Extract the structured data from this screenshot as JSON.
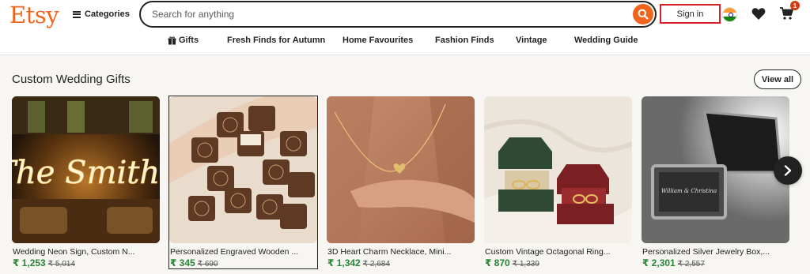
{
  "header": {
    "logo": "Etsy",
    "categories_label": "Categories",
    "search_placeholder": "Search for anything",
    "signin_label": "Sign in",
    "cart_count": "1"
  },
  "nav": {
    "items": [
      "Gifts",
      "Fresh Finds for Autumn",
      "Home Favourites",
      "Fashion Finds",
      "Vintage",
      "Wedding Guide"
    ]
  },
  "section": {
    "title": "Custom Wedding Gifts",
    "view_all_label": "View all"
  },
  "products": [
    {
      "title": "Wedding Neon Sign, Custom N...",
      "price": "₹ 1,253",
      "original": "₹ 5,014",
      "image_text": "The Smiths"
    },
    {
      "title": "Personalized Engraved Wooden ...",
      "price": "₹ 345",
      "original": "₹ 690"
    },
    {
      "title": "3D Heart Charm Necklace, Mini...",
      "price": "₹ 1,342",
      "original": "₹ 2,684"
    },
    {
      "title": "Custom Vintage Octagonal Ring...",
      "price": "₹ 870",
      "original": "₹ 1,339"
    },
    {
      "title": "Personalized Silver Jewelry Box,...",
      "price": "₹ 2,301",
      "original": "₹ 2,557",
      "image_text": "William & Christina"
    }
  ],
  "colors": {
    "brand": "#f1641e",
    "price": "#258635",
    "highlight": "#d91f26"
  }
}
